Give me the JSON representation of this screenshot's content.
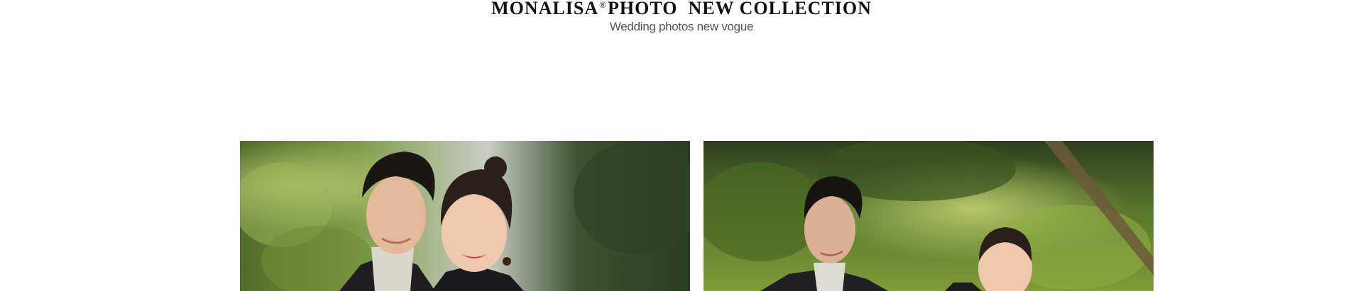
{
  "header": {
    "brand": "MONALISA",
    "registered_mark": "®",
    "title_rest": "PHOTO  NEW COLLECTION",
    "subtitle": "Wedding photos new vogue"
  },
  "gallery": {
    "photos": [
      {
        "alt": "Couple portrait close-up with greenery background"
      },
      {
        "alt": "Couple in formal wear standing among trees"
      }
    ]
  },
  "colors": {
    "background": "#ffffff",
    "title": "#111111",
    "subtitle": "#555555"
  }
}
